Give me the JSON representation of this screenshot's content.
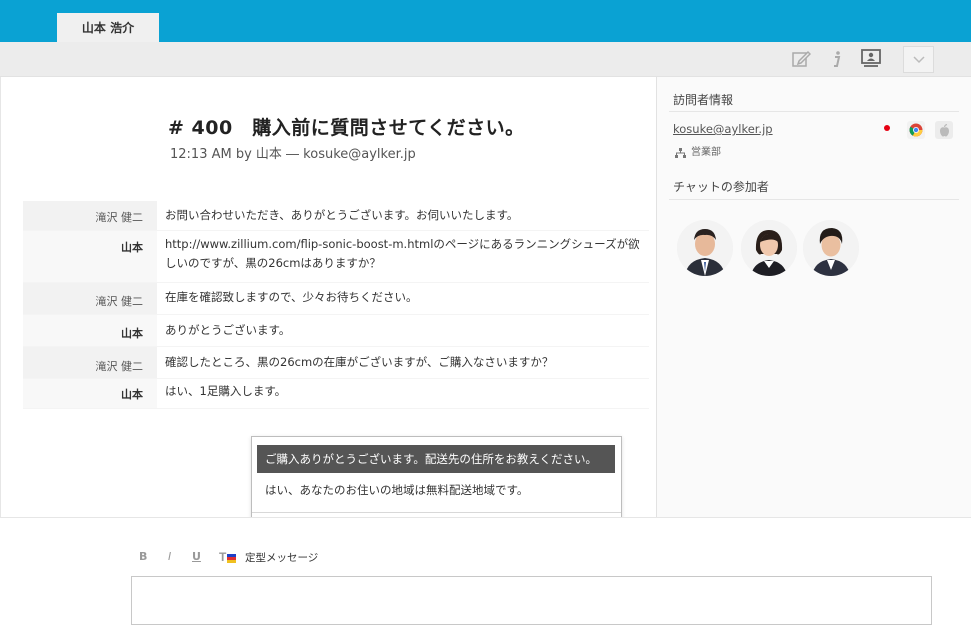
{
  "tabs": [
    {
      "label": "山本 浩介"
    }
  ],
  "toolbar": {
    "icons": [
      "edit-icon",
      "info-icon",
      "presentation-icon",
      "chevron-down-icon"
    ]
  },
  "ticket": {
    "title": "# 400　購入前に質問させてください。",
    "meta": "12:13 AM by 山本 ― kosuke@aylker.jp"
  },
  "messages": [
    {
      "author": "滝沢 健二",
      "text": "お問い合わせいただき、ありがとうございます。お伺いいたします。"
    },
    {
      "author": "山本",
      "text": "http://www.zillium.com/flip-sonic-boost-m.htmlのページにあるランニングシューズが欲しいのですが、黒の26cmはありますか？"
    },
    {
      "author": "滝沢 健二",
      "text": "在庫を確認致しますので、少々お待ちください。"
    },
    {
      "author": "山本",
      "text": "ありがとうございます。"
    },
    {
      "author": "滝沢 健二",
      "text": "確認したところ、黒の26cmの在庫がございますが、ご購入なさいますか？"
    },
    {
      "author": "山本",
      "text": "はい、1足購入します。"
    }
  ],
  "visitor": {
    "heading": "訪問者情報",
    "email": "kosuke@aylker.jp",
    "department": "営業部",
    "icons": [
      "japan-flag-icon",
      "chrome-icon",
      "apple-icon"
    ],
    "colors": {
      "flag": "#e60012"
    }
  },
  "participants": {
    "heading": "チャットの参加者",
    "avatars": [
      "avatar-man-suit",
      "avatar-woman",
      "avatar-young-man"
    ]
  },
  "templates": {
    "items": [
      "ご購入ありがとうございます。配送先の住所をお教えください。",
      "はい、あなたのお住いの地域は無料配送地域です。"
    ],
    "search_placeholder": ""
  },
  "composer": {
    "bold": "B",
    "italic": "I",
    "underline": "U",
    "template_label": "定型メッセージ",
    "value": ""
  },
  "colors": {
    "accent": "#0aa2d3",
    "selected": "#555555"
  }
}
